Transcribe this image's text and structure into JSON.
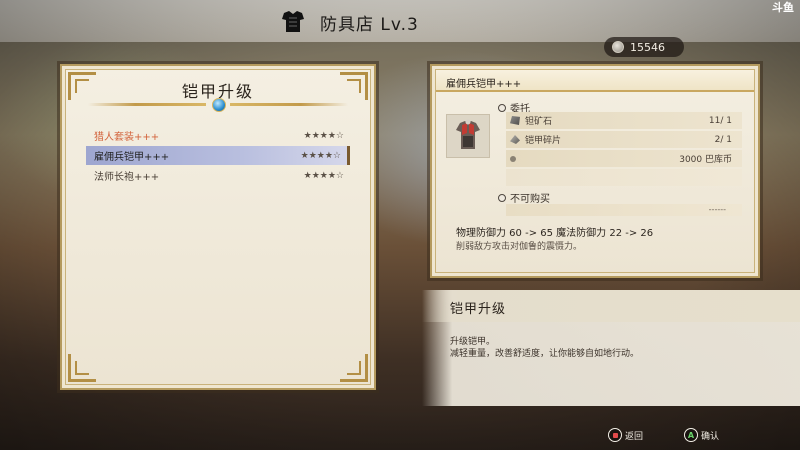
{
  "shop": {
    "title": "防具店 Lv.3",
    "icon": "armor-icon"
  },
  "watermark": {
    "text": "斗鱼"
  },
  "currency": {
    "amount": "15546",
    "icon": "coin-icon"
  },
  "left_panel": {
    "title": "铠甲升级",
    "items": [
      {
        "name": "猎人套装+++",
        "stars": "★★★★☆",
        "highlight": true,
        "selected": false
      },
      {
        "name": "雇佣兵铠甲+++",
        "stars": "★★★★☆",
        "highlight": false,
        "selected": true
      },
      {
        "name": "法师长袍+++",
        "stars": "★★★★☆",
        "highlight": false,
        "selected": false
      }
    ]
  },
  "detail": {
    "header": "雇佣兵铠甲+++",
    "commission_label": "委托",
    "materials": [
      {
        "name": "钽矿石",
        "count": "11/ 1",
        "icon": "ore-icon"
      },
      {
        "name": "铠甲碎片",
        "count": "2/ 1",
        "icon": "shard-icon"
      },
      {
        "name": "",
        "count": "3000 巴库币",
        "icon": "coin-small-icon"
      }
    ],
    "not_buyable_label": "不可购买",
    "not_buyable_value": "------",
    "stats": "物理防御力 60 -> 65  魔法防御力 22 -> 26",
    "description": "削弱敌方攻击对伽鲁的震慑力。"
  },
  "info": {
    "title": "铠甲升级",
    "line1": "升级铠甲。",
    "line2": "减轻重量，改善舒适度，让你能够自如地行动。"
  },
  "prompts": {
    "back": "返回",
    "confirm": "确认"
  },
  "colors": {
    "highlight_text": "#d2623a",
    "selected_row": "#9ea6d0",
    "panel_border": "#b49a5e"
  }
}
